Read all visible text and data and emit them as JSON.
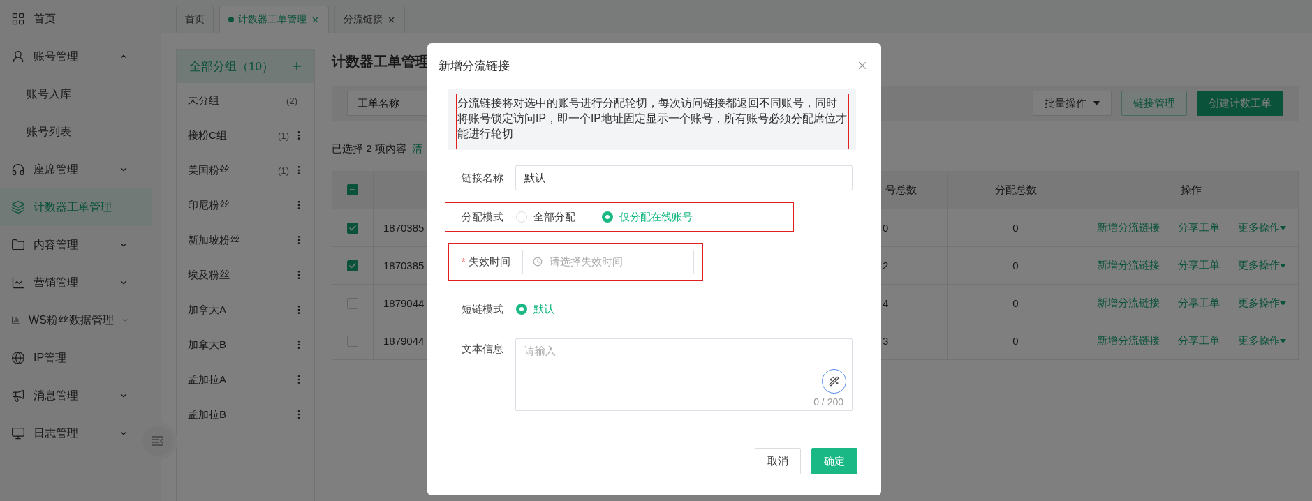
{
  "sidebar": {
    "items": [
      {
        "kind": "link",
        "label": "首页",
        "selected": false
      },
      {
        "kind": "group",
        "label": "账号管理",
        "selected": false,
        "expanded": true,
        "children": [
          {
            "label": "账号入库",
            "selected": false
          },
          {
            "label": "账号列表",
            "selected": false
          }
        ]
      },
      {
        "kind": "group",
        "label": "座席管理",
        "selected": false,
        "expanded": false
      },
      {
        "kind": "link",
        "label": "计数器工单管理",
        "selected": true
      },
      {
        "kind": "group",
        "label": "内容管理",
        "selected": false,
        "expanded": false
      },
      {
        "kind": "group",
        "label": "营销管理",
        "selected": false,
        "expanded": false
      },
      {
        "kind": "group",
        "label": "WS粉丝数据管理",
        "selected": false,
        "expanded": false
      },
      {
        "kind": "link",
        "label": "IP管理",
        "selected": false
      },
      {
        "kind": "group",
        "label": "消息管理",
        "selected": false,
        "expanded": false
      },
      {
        "kind": "group",
        "label": "日志管理",
        "selected": false,
        "expanded": false
      }
    ]
  },
  "tabs": [
    {
      "label": "首页",
      "selected": false,
      "closable": false
    },
    {
      "label": "计数器工单管理",
      "selected": true,
      "closable": true
    },
    {
      "label": "分流链接",
      "selected": false,
      "closable": true
    }
  ],
  "groups": {
    "header": {
      "label": "全部分组（10）",
      "selected": true
    },
    "items": [
      {
        "kind": "fixed",
        "name": "未分组",
        "count": "(2)",
        "selected": false
      },
      {
        "kind": "custom",
        "name": "接粉C组",
        "count": "(1)",
        "selected": false
      },
      {
        "kind": "custom",
        "name": "美国粉丝",
        "count": "(1)",
        "selected": false
      },
      {
        "kind": "custom",
        "name": "印尼粉丝",
        "selected": false
      },
      {
        "kind": "custom",
        "name": "新加坡粉丝",
        "selected": false
      },
      {
        "kind": "custom",
        "name": "埃及粉丝",
        "selected": false
      },
      {
        "kind": "custom",
        "name": "加拿大A",
        "selected": false
      },
      {
        "kind": "custom",
        "name": "加拿大B",
        "selected": false
      },
      {
        "kind": "custom",
        "name": "孟加拉A",
        "selected": false
      },
      {
        "kind": "custom",
        "name": "孟加拉B",
        "selected": false
      }
    ]
  },
  "page": {
    "title": "计数器工单管理",
    "filter_select": {
      "value": "工单名称"
    },
    "buttons": [
      {
        "kind": "dropdown",
        "label": "批量操作"
      },
      {
        "kind": "outline",
        "label": "链接管理"
      },
      {
        "kind": "primary",
        "label": "创建计数工单"
      }
    ],
    "selection": {
      "text": "已选择 2 项内容",
      "clear_link": "清"
    }
  },
  "table": {
    "header_checkbox": {
      "indeterminate": true
    },
    "columns": [
      "号总数",
      "分配总数",
      "操作"
    ],
    "rows": [
      {
        "selected": true,
        "column_1": "1870385",
        "column_3": "0",
        "allocated": "0",
        "actions": [
          "新增分流链接",
          "分享工单",
          "更多操作"
        ]
      },
      {
        "selected": true,
        "column_1": "1870385",
        "column_3": "2",
        "allocated": "0",
        "actions": [
          "新增分流链接",
          "分享工单",
          "更多操作"
        ]
      },
      {
        "selected": false,
        "column_1": "1879044",
        "column_3": "4",
        "allocated": "0",
        "actions": [
          "新增分流链接",
          "分享工单",
          "更多操作"
        ]
      },
      {
        "selected": false,
        "column_1": "1879044",
        "column_3": "3",
        "allocated": "0",
        "actions": [
          "新增分流链接",
          "分享工单",
          "更多操作"
        ]
      }
    ]
  },
  "dialog": {
    "title": "新增分流链接",
    "notice": "分流链接将对选中的账号进行分配轮切，每次访问链接都返回不同账号，同时将账号锁定访问IP，即一个IP地址固定显示一个账号，所有账号必须分配席位才能进行轮切",
    "notice_highlighted": true,
    "fields": [
      {
        "kind": "text",
        "label": "链接名称",
        "value": "默认",
        "highlighted": false
      },
      {
        "kind": "radio",
        "label": "分配模式",
        "highlighted": true,
        "options": [
          {
            "label": "全部分配",
            "selected": false
          },
          {
            "label": "仅分配在线账号",
            "selected": true
          }
        ]
      },
      {
        "kind": "time",
        "label": "失效时间",
        "required_mark": "*",
        "placeholder": "请选择失效时间",
        "highlighted": true
      },
      {
        "kind": "radio",
        "label": "短链模式",
        "highlighted": false,
        "options": [
          {
            "label": "默认",
            "selected": true
          }
        ]
      },
      {
        "kind": "textarea",
        "label": "文本信息",
        "placeholder": "请输入",
        "counter": "0 / 200",
        "highlighted": false
      }
    ],
    "buttons": [
      {
        "kind": "default",
        "label": "取消"
      },
      {
        "kind": "primary",
        "label": "确定"
      }
    ]
  }
}
